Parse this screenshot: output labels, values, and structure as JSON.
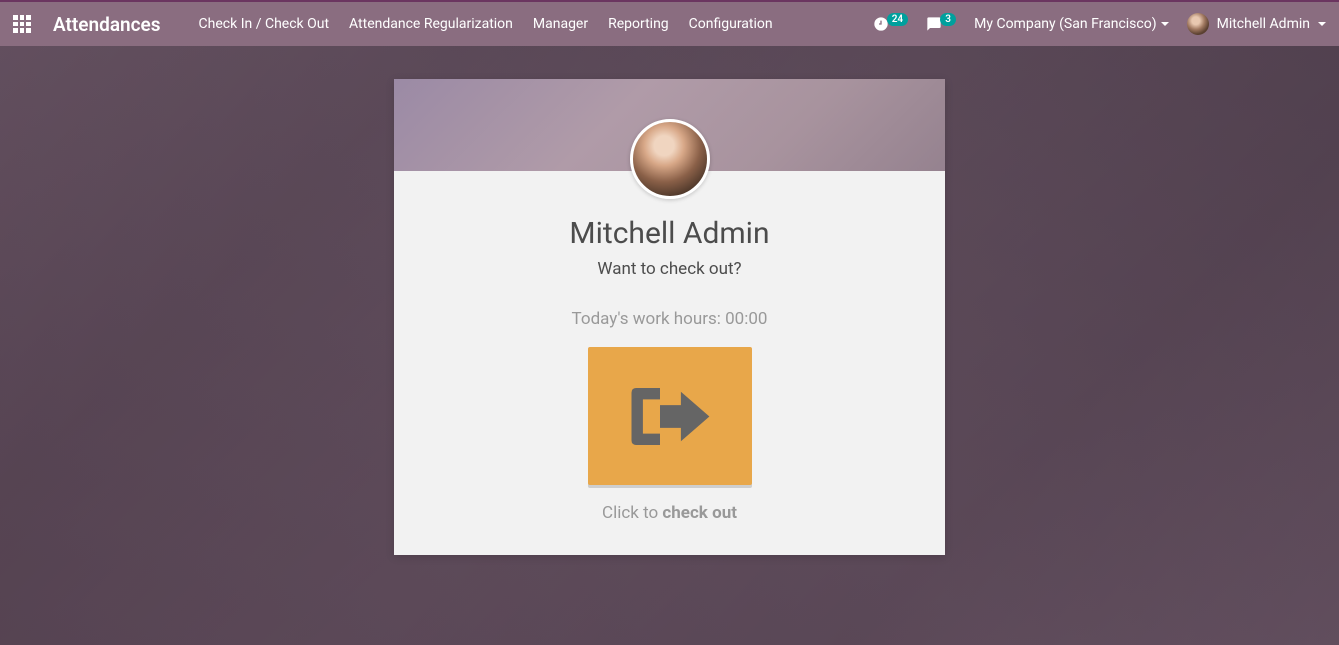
{
  "navbar": {
    "brand": "Attendances",
    "menu": [
      "Check In / Check Out",
      "Attendance Regularization",
      "Manager",
      "Reporting",
      "Configuration"
    ],
    "activity_count": "24",
    "message_count": "3",
    "company": "My Company (San Francisco)",
    "user_name": "Mitchell Admin"
  },
  "card": {
    "employee_name": "Mitchell Admin",
    "prompt": "Want to check out?",
    "work_hours_label": "Today's work hours: ",
    "work_hours_value": "00:00",
    "instruction_prefix": "Click to ",
    "instruction_action": "check out"
  }
}
